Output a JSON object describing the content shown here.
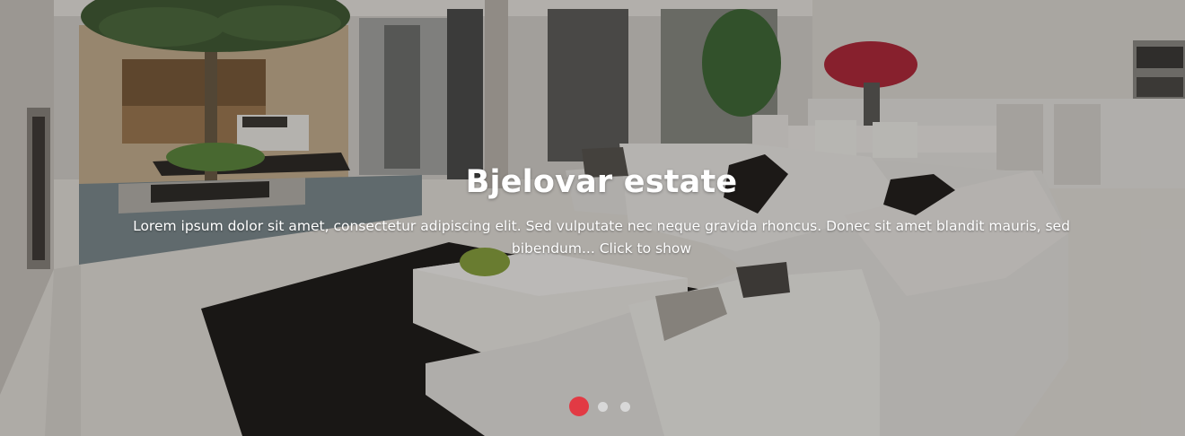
{
  "slide": {
    "title": "Bjelovar estate",
    "description": "Lorem ipsum dolor sit amet, consectetur adipiscing elit. Sed vulputate nec neque gravida rhoncus. Donec sit amet blandit mauris, sed bibendum... Click to show"
  },
  "pagination": {
    "total": 3,
    "active_index": 0
  },
  "colors": {
    "accent": "#e23a44",
    "inactive_dot": "#d8d8d8",
    "caption_text": "#ffffff"
  }
}
